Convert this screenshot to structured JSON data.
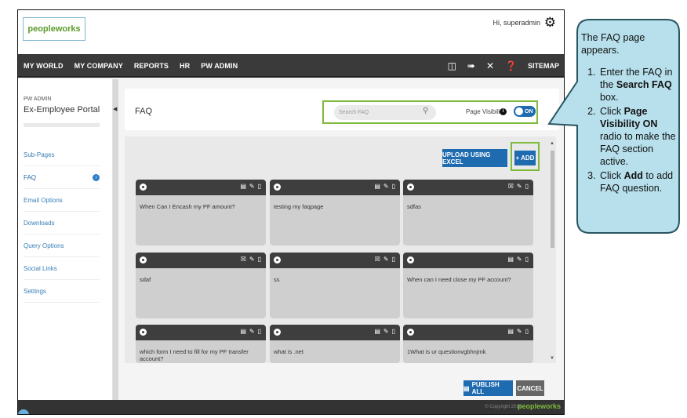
{
  "header": {
    "logo": "peopleworks",
    "greeting": "Hi, superadmin",
    "icon": "gear-icon"
  },
  "nav": {
    "items": [
      "MY WORLD",
      "MY COMPANY",
      "REPORTS",
      "HR",
      "PW ADMIN"
    ],
    "right_icons": [
      "book-icon",
      "pin-icon",
      "tools-icon",
      "help-icon"
    ],
    "sitemap": "SITEMAP"
  },
  "sidebar": {
    "small_label": "PW ADMIN",
    "title": "Ex-Employee Portal",
    "items": [
      {
        "label": "Sub-Pages"
      },
      {
        "label": "FAQ"
      },
      {
        "label": "Email Options"
      },
      {
        "label": "Downloads"
      },
      {
        "label": "Query Options"
      },
      {
        "label": "Social Links"
      },
      {
        "label": "Settings"
      }
    ],
    "active_index": 1
  },
  "main": {
    "title": "FAQ",
    "search_placeholder": "Search FAQ",
    "page_visibility_label": "Page Visibility",
    "toggle_label": "ON",
    "upload_label": "UPLOAD USING EXCEL",
    "add_label": "+ ADD",
    "faqs": [
      {
        "question": "When Can I Encash my PF amount?"
      },
      {
        "question": "testing my faqpage"
      },
      {
        "question": "sdfas"
      },
      {
        "question": "sdaf"
      },
      {
        "question": "ss"
      },
      {
        "question": "When can I need close my PF account?"
      },
      {
        "question": "which form I need to fill for my PF transfer account?"
      },
      {
        "question": "what is .net"
      },
      {
        "question": "1What is ur questionvgbhnjmk"
      }
    ],
    "publish_label": "PUBLISH ALL",
    "cancel_label": "CANCEL"
  },
  "footer": {
    "copyright": "© Copyright 2016",
    "logo": "peopleworks"
  },
  "callout": {
    "intro": "The FAQ page appears.",
    "steps": [
      {
        "pre": "Enter the FAQ in the ",
        "bold": "Search FAQ",
        "post": " box."
      },
      {
        "pre": "Click ",
        "bold": "Page Visibility ON",
        "post": " radio to make the FAQ section active."
      },
      {
        "pre": "Click ",
        "bold": "Add",
        "post": " to add FAQ question."
      }
    ],
    "bubble_color": "#b7e0ec",
    "border_color": "#2a5560"
  }
}
